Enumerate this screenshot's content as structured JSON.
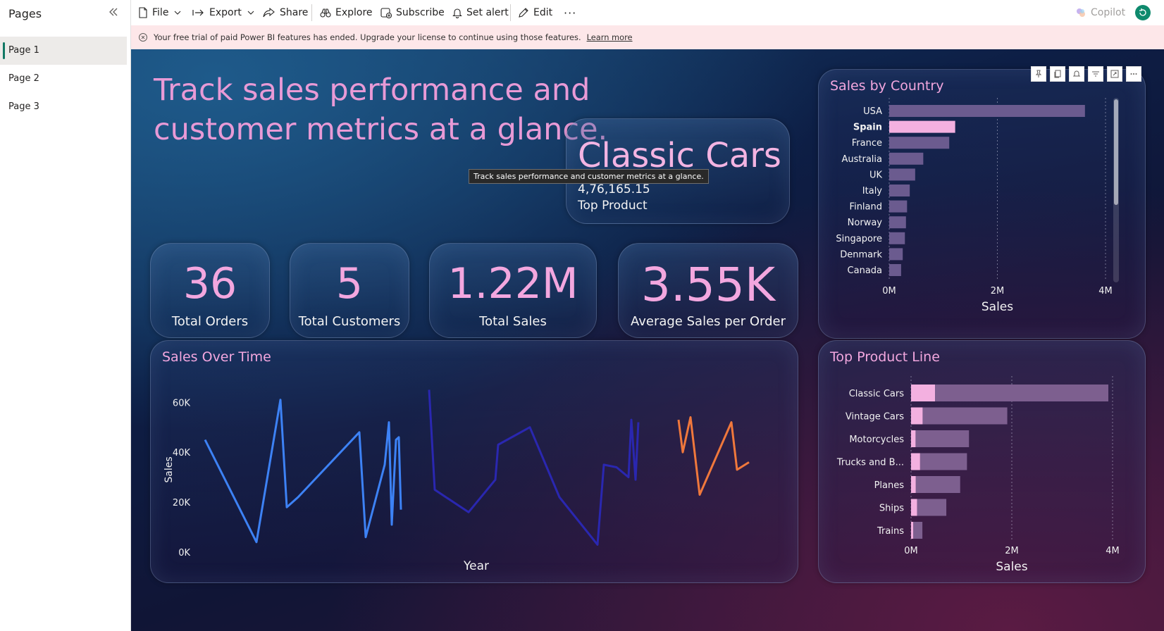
{
  "pages_pane": {
    "title": "Pages",
    "collapse_icon": "chevron-double-left-icon",
    "items": [
      {
        "label": "Page 1",
        "active": true
      },
      {
        "label": "Page 2",
        "active": false
      },
      {
        "label": "Page 3",
        "active": false
      }
    ]
  },
  "toolbar": {
    "file": "File",
    "export": "Export",
    "share": "Share",
    "explore": "Explore",
    "subscribe": "Subscribe",
    "set_alert": "Set alert",
    "edit": "Edit",
    "more": "···",
    "copilot": "Copilot"
  },
  "banner": {
    "message": "Your free trial of paid Power BI features has ended. Upgrade your license to continue using those features.",
    "link": "Learn more"
  },
  "report": {
    "headline": "Track sales performance and customer metrics at a glance.",
    "tooltip": "Track sales performance and customer metrics at a glance.",
    "top_product": {
      "name": "Classic Cars",
      "value": "4,76,165.15",
      "label": "Top Product"
    },
    "kpis": [
      {
        "value": "36",
        "label": "Total Orders"
      },
      {
        "value": "5",
        "label": "Total Customers"
      },
      {
        "value": "1.22M",
        "label": "Total Sales"
      },
      {
        "value": "3.55K",
        "label": "Average Sales per Order"
      }
    ],
    "colors": {
      "accent_pink": "#f3a7df",
      "bar_muted": "#6b5b8f",
      "bar_highlight": "#f3b0e0",
      "line_2003": "#3d82f5",
      "line_2004": "#2a27b0",
      "line_2005": "#f0783c"
    }
  },
  "chart_data": [
    {
      "type": "bar",
      "orientation": "horizontal",
      "title": "Sales by Country",
      "xlabel": "Sales",
      "ylabel": "",
      "xlim": [
        0,
        4000000
      ],
      "ticks": [
        "0M",
        "2M",
        "4M"
      ],
      "categories": [
        "USA",
        "Spain",
        "France",
        "Australia",
        "UK",
        "Italy",
        "Finland",
        "Norway",
        "Singapore",
        "Denmark",
        "Canada"
      ],
      "values": [
        3620000,
        1220000,
        1110000,
        630000,
        480000,
        380000,
        330000,
        310000,
        290000,
        250000,
        220000
      ],
      "highlighted": "Spain",
      "grid": true
    },
    {
      "type": "line",
      "title": "Sales Over Time",
      "xlabel": "Year",
      "ylabel": "Sales",
      "ylim": [
        0,
        66000
      ],
      "y_ticks": [
        "0K",
        "20K",
        "40K",
        "60K"
      ],
      "series": [
        {
          "values": [
            45000,
            4000,
            61000,
            18000,
            22000,
            48000,
            6000,
            35000,
            52000,
            11000,
            45000,
            46000,
            17000
          ]
        },
        {
          "values": [
            65000,
            25000,
            16000,
            29000,
            43000,
            50000,
            22000,
            3000,
            35000,
            34000,
            30000,
            53000,
            29000,
            52000
          ]
        },
        {
          "values": [
            53000,
            40000,
            54000,
            23000,
            52000,
            33000,
            36000
          ]
        }
      ]
    },
    {
      "type": "bar",
      "orientation": "horizontal",
      "stacked": true,
      "title": "Top Product Line",
      "xlabel": "Sales",
      "ylabel": "",
      "xlim": [
        0,
        4000000
      ],
      "ticks": [
        "0M",
        "2M",
        "4M"
      ],
      "categories": [
        "Classic Cars",
        "Vintage Cars",
        "Motorcycles",
        "Trucks and B...",
        "Planes",
        "Ships",
        "Trains"
      ],
      "series": [
        {
          "values": [
            476165,
            230000,
            90000,
            180000,
            95000,
            120000,
            45000
          ]
        },
        {
          "values": [
            3440000,
            1680000,
            1060000,
            930000,
            880000,
            580000,
            180000
          ]
        }
      ],
      "grid": true
    }
  ]
}
